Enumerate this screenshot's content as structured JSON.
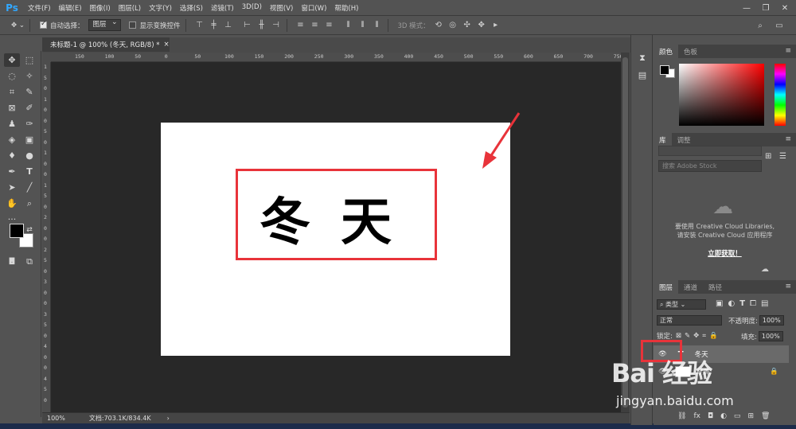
{
  "app": {
    "logo": "Ps"
  },
  "menu": [
    "文件(F)",
    "编辑(E)",
    "图像(I)",
    "图层(L)",
    "文字(Y)",
    "选择(S)",
    "滤镜(T)",
    "3D(D)",
    "视图(V)",
    "窗口(W)",
    "帮助(H)"
  ],
  "window_controls": {
    "minimize": "—",
    "restore": "❐",
    "close": "✕"
  },
  "options": {
    "auto_select_label": "自动选择：",
    "auto_select_value": "图层",
    "show_transform_label": "显示变换控件",
    "mode3d_label": "3D 模式："
  },
  "document": {
    "tab_title": "未标题-1 @ 100% (冬天, RGB/8) *",
    "tab_close": "×",
    "canvas_text": "冬天",
    "zoom": "100%",
    "doc_info": "文档:703.1K/834.4K",
    "status_arrow": "›"
  },
  "ruler": {
    "h_ticks": [
      "150",
      "100",
      "50",
      "0",
      "50",
      "100",
      "150",
      "200",
      "250",
      "300",
      "350",
      "400",
      "450",
      "500",
      "550",
      "600",
      "650",
      "700",
      "750"
    ],
    "v_ticks": [
      "1",
      "5",
      "0",
      "1",
      "0",
      "0",
      "5",
      "0",
      "1",
      "0",
      "0",
      "1",
      "5",
      "0",
      "2",
      "0",
      "0",
      "2",
      "5",
      "0",
      "3",
      "0",
      "0",
      "3",
      "5",
      "0",
      "4",
      "0",
      "0",
      "4",
      "5",
      "0"
    ]
  },
  "color_panel": {
    "tabs": [
      "颜色",
      "色板"
    ]
  },
  "library_panel": {
    "tabs": [
      "库",
      "调整"
    ],
    "search_placeholder": "搜索 Adobe Stock",
    "line1": "要使用 Creative Cloud Libraries,",
    "line2": "请安装 Creative Cloud 应用程序",
    "link": "立即获取！"
  },
  "layers_panel": {
    "tabs": [
      "图层",
      "通道",
      "路径"
    ],
    "filter_label": "类型",
    "blend_mode": "正常",
    "opacity_label": "不透明度:",
    "opacity_value": "100%",
    "lock_label": "锁定:",
    "fill_label": "填充:",
    "fill_value": "100%",
    "layers": [
      {
        "name": "冬天"
      },
      {
        "name": "背景"
      }
    ],
    "footer_icons": [
      "⛓",
      "fx",
      "◘",
      "◐",
      "▭",
      "⊞",
      "🗑"
    ]
  },
  "watermark": {
    "logo": "Bai  经验",
    "url": "jingyan.baidu.com"
  },
  "colors": {
    "accent_red": "#e8333a",
    "ps_blue": "#31a8ff"
  }
}
